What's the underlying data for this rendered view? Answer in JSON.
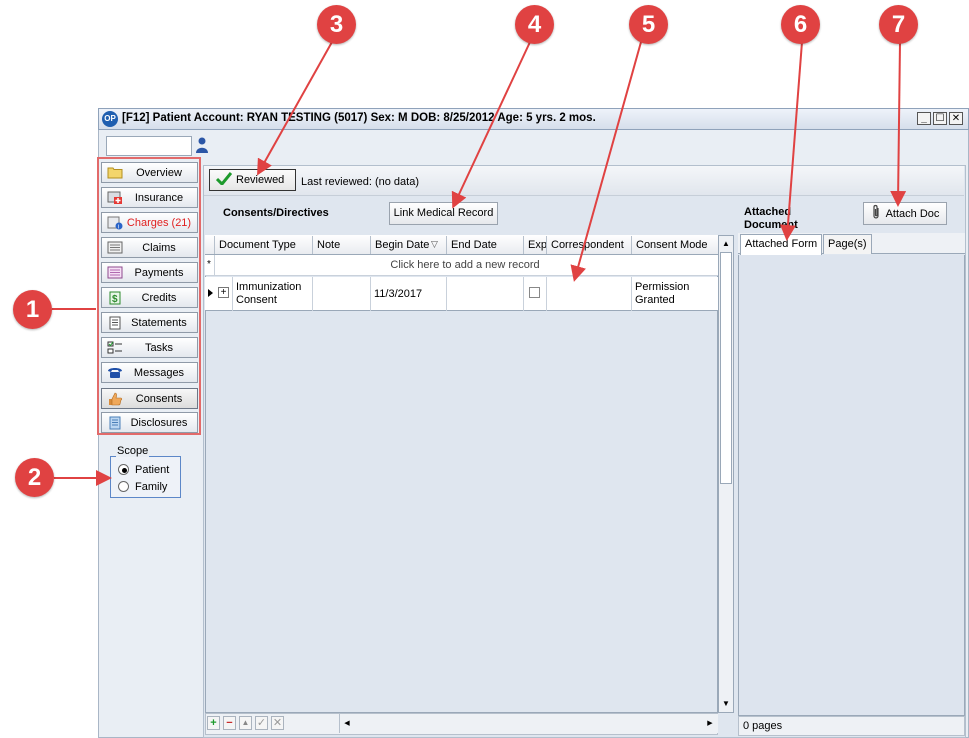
{
  "window": {
    "title": "[F12] Patient Account: RYAN TESTING (5017)  Sex: M  DOB: 8/25/2012  Age: 5 yrs. 2 mos.",
    "controls": {
      "minimize": "_",
      "maximize": "☐",
      "close": "✕"
    },
    "title_icon": "OP"
  },
  "nav": {
    "items": [
      {
        "label": "Overview",
        "icon": "folder-icon"
      },
      {
        "label": "Insurance",
        "icon": "insurance-card-icon"
      },
      {
        "label": "Charges (21)",
        "icon": "charges-icon",
        "alert": true
      },
      {
        "label": "Claims",
        "icon": "claims-icon"
      },
      {
        "label": "Payments",
        "icon": "payments-icon"
      },
      {
        "label": "Credits",
        "icon": "dollar-icon"
      },
      {
        "label": "Statements",
        "icon": "statement-icon"
      },
      {
        "label": "Tasks",
        "icon": "tasks-icon"
      },
      {
        "label": "Messages",
        "icon": "phone-icon"
      },
      {
        "label": "Consents",
        "icon": "thumbs-up-icon",
        "active": true
      },
      {
        "label": "Disclosures",
        "icon": "disclosure-icon"
      }
    ]
  },
  "scope": {
    "legend": "Scope",
    "options": [
      {
        "label": "Patient",
        "selected": true
      },
      {
        "label": "Family",
        "selected": false
      }
    ]
  },
  "review": {
    "button_label": "Reviewed",
    "last_reviewed": "Last reviewed: (no data)"
  },
  "consents": {
    "title": "Consents/Directives",
    "link_button": "Link Medical Record",
    "columns": [
      "Document Type",
      "Note",
      "Begin Date",
      "End Date",
      "Exp",
      "Correspondent",
      "Consent Mode"
    ],
    "sort_indicator": "▽",
    "new_row_text": "Click here to add a new record",
    "new_row_marker": "*",
    "rows": [
      {
        "document_type": "Immunization Consent",
        "note": "",
        "begin_date": "11/3/2017",
        "end_date": "",
        "expired": false,
        "correspondent": "",
        "consent_mode": "Permission Granted"
      }
    ],
    "tools": {
      "add": "+",
      "remove": "−",
      "up": "▲",
      "confirm": "✓",
      "cancel": "✕"
    }
  },
  "attached": {
    "label": "Attached Document",
    "attach_button": "Attach Doc",
    "tabs": [
      "Attached Form",
      "Page(s)"
    ],
    "status": "0 pages"
  },
  "callouts": [
    "1",
    "2",
    "3",
    "4",
    "5",
    "6",
    "7"
  ],
  "colors": {
    "callout": "#e04242",
    "highlight_border": "#e26a6a",
    "alert_text": "#e02020",
    "check": "#1d9a2c"
  }
}
